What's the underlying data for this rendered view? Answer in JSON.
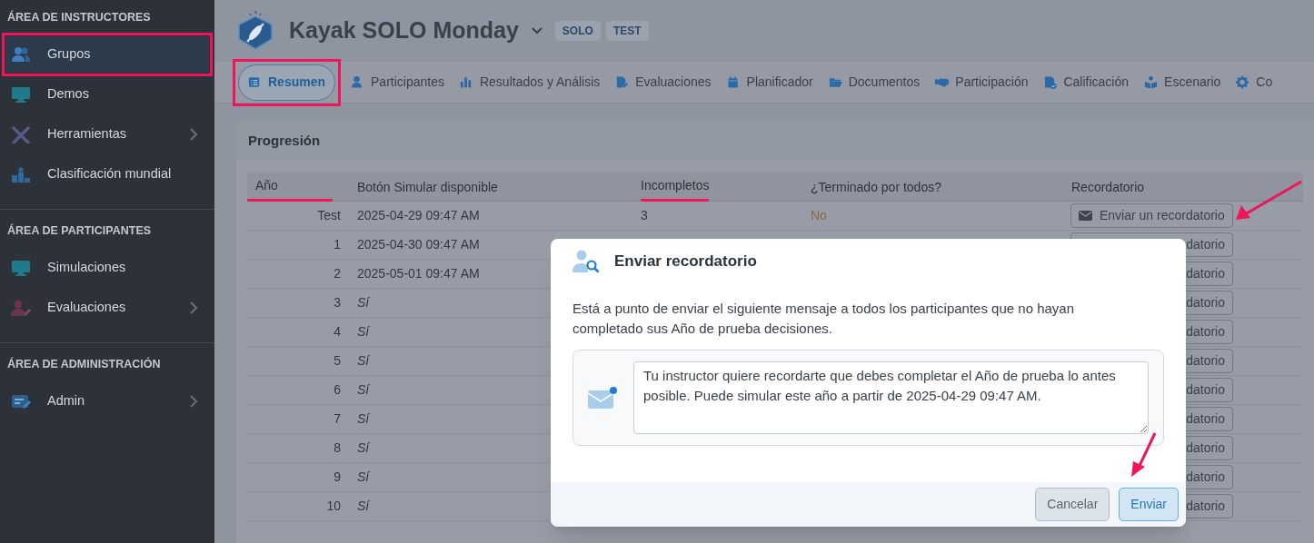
{
  "sidebar": {
    "sections": [
      {
        "heading": "ÁREA DE INSTRUCTORES",
        "items": [
          {
            "label": "Grupos",
            "selected": true,
            "highlighted": true,
            "submenu": false
          },
          {
            "label": "Demos",
            "selected": false,
            "highlighted": false,
            "submenu": false
          },
          {
            "label": "Herramientas",
            "selected": false,
            "highlighted": false,
            "submenu": true
          },
          {
            "label": "Clasificación mundial",
            "selected": false,
            "highlighted": false,
            "submenu": false
          }
        ]
      },
      {
        "heading": "ÁREA DE PARTICIPANTES",
        "items": [
          {
            "label": "Simulaciones",
            "selected": false,
            "highlighted": false,
            "submenu": false
          },
          {
            "label": "Evaluaciones",
            "selected": false,
            "highlighted": false,
            "submenu": true
          }
        ]
      },
      {
        "heading": "ÁREA DE ADMINISTRACIÓN",
        "items": [
          {
            "label": "Admin",
            "selected": false,
            "highlighted": false,
            "submenu": true
          }
        ]
      }
    ]
  },
  "header": {
    "title": "Kayak SOLO Monday",
    "badges": [
      "SOLO",
      "TEST"
    ]
  },
  "tabs": [
    {
      "label": "Resumen",
      "selected": true,
      "highlighted": true
    },
    {
      "label": "Participantes",
      "selected": false,
      "highlighted": false
    },
    {
      "label": "Resultados y Análisis",
      "selected": false,
      "highlighted": false
    },
    {
      "label": "Evaluaciones",
      "selected": false,
      "highlighted": false
    },
    {
      "label": "Planificador",
      "selected": false,
      "highlighted": false
    },
    {
      "label": "Documentos",
      "selected": false,
      "highlighted": false
    },
    {
      "label": "Participación",
      "selected": false,
      "highlighted": false
    },
    {
      "label": "Calificación",
      "selected": false,
      "highlighted": false
    },
    {
      "label": "Escenario",
      "selected": false,
      "highlighted": false
    },
    {
      "label": "Co",
      "selected": false,
      "highlighted": false
    }
  ],
  "progress": {
    "title": "Progresión",
    "columns": [
      {
        "label": "Año",
        "underlined": true
      },
      {
        "label": "Botón Simular disponible",
        "underlined": false
      },
      {
        "label": "Incompletos",
        "underlined": true
      },
      {
        "label": "¿Terminado por todos?",
        "underlined": false
      },
      {
        "label": "Recordatorio",
        "underlined": false
      }
    ],
    "rows": [
      {
        "year": "Test",
        "available": "2025-04-29 09:47 AM",
        "kind": "date",
        "incomplete": "3",
        "finished": "No",
        "reminder": "Enviar un recordatorio",
        "covered": false,
        "pointed": true
      },
      {
        "year": "1",
        "available": "2025-04-30 09:47 AM",
        "kind": "date",
        "reminder": "datorio",
        "covered": true,
        "pointed": false
      },
      {
        "year": "2",
        "available": "2025-05-01 09:47 AM",
        "kind": "date",
        "reminder": "datorio",
        "covered": true,
        "pointed": false
      },
      {
        "year": "3",
        "available": "Sí",
        "kind": "flag",
        "reminder": "datorio",
        "covered": true,
        "pointed": false
      },
      {
        "year": "4",
        "available": "Sí",
        "kind": "flag",
        "reminder": "datorio",
        "covered": true,
        "pointed": false
      },
      {
        "year": "5",
        "available": "Sí",
        "kind": "flag",
        "reminder": "datorio",
        "covered": true,
        "pointed": false
      },
      {
        "year": "6",
        "available": "Sí",
        "kind": "flag",
        "reminder": "datorio",
        "covered": true,
        "pointed": false
      },
      {
        "year": "7",
        "available": "Sí",
        "kind": "flag",
        "reminder": "datorio",
        "covered": true,
        "pointed": false
      },
      {
        "year": "8",
        "available": "Sí",
        "kind": "flag",
        "reminder": "datorio",
        "covered": true,
        "pointed": false
      },
      {
        "year": "9",
        "available": "Sí",
        "kind": "flag",
        "reminder": "datorio",
        "covered": true,
        "pointed": false
      },
      {
        "year": "10",
        "available": "Sí",
        "kind": "flag",
        "reminder": "datorio",
        "covered": true,
        "pointed": false
      }
    ]
  },
  "modal": {
    "title": "Enviar recordatorio",
    "text": "Está a punto de enviar el siguiente mensaje a todos los participantes que no hayan completado sus Año de prueba decisiones.",
    "message": "Tu instructor quiere recordarte que debes completar el Año de prueba lo antes posible. Puede simular este año a partir de 2025-04-29 09:47 AM.",
    "buttons": [
      {
        "label": "Cancelar",
        "kind": "secondary",
        "pointed": false
      },
      {
        "label": "Enviar",
        "kind": "primary",
        "pointed": true
      }
    ]
  }
}
